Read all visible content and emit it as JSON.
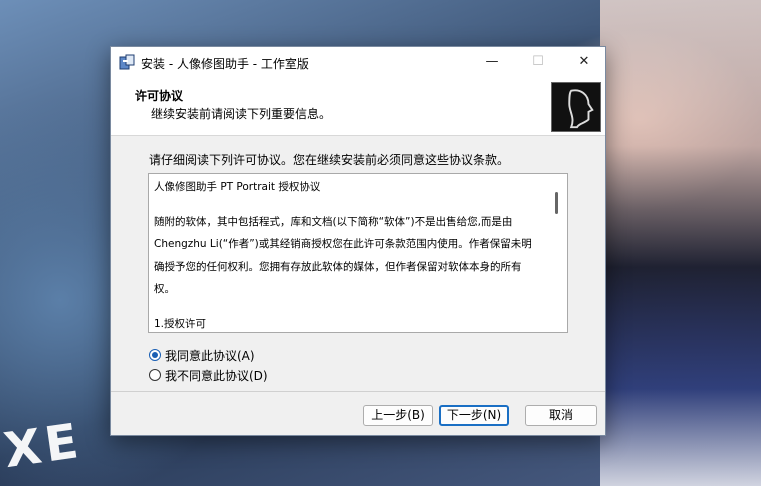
{
  "window": {
    "title": "安装 - 人像修图助手 - 工作室版"
  },
  "header": {
    "title": "许可协议",
    "subtitle": "继续安装前请阅读下列重要信息。"
  },
  "instruction": "请仔细阅读下列许可协议。您在继续安装前必须同意这些协议条款。",
  "license": {
    "lines": [
      "人像修图助手 PT Portrait 授权协议",
      "随附的软体，其中包括程式，库和文档(以下简称“软体”)不是出售给您,而是由",
      "Chengzhu Li(“作者”)或其经销商授权您在此许可条款范围内使用。作者保留未明",
      "确授予您的任何权利。您拥有存放此软体的媒体，但作者保留对软体本身的所有",
      "权。",
      "1.授权许可"
    ]
  },
  "options": {
    "accept": "我同意此协议(A)",
    "decline": "我不同意此协议(D)",
    "selected": "accept"
  },
  "buttons": {
    "back": "上一步(B)",
    "next": "下一步(N)",
    "cancel": "取消"
  },
  "background": {
    "text": "XE"
  },
  "colors": {
    "accent": "#1a6fc4"
  }
}
